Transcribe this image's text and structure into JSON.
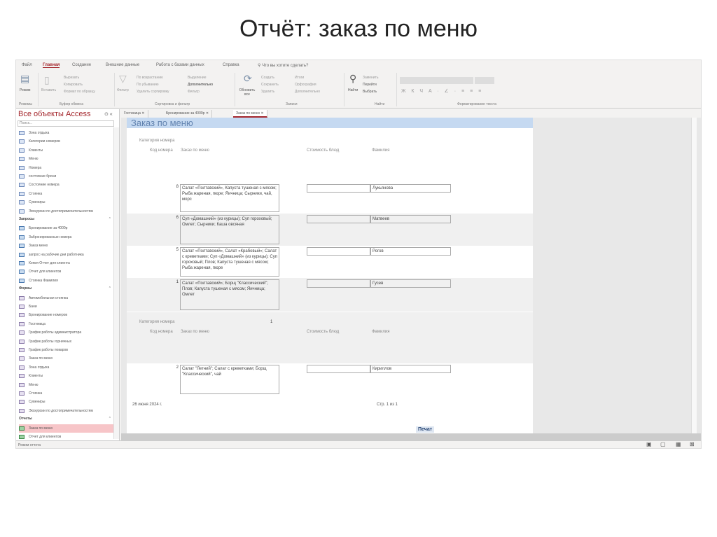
{
  "slide_title": "Отчёт: заказ по меню",
  "ribbon": {
    "menu": [
      "Файл",
      "Главная",
      "Создание",
      "Внешние данные",
      "Работа с базами данных",
      "Справка"
    ],
    "tell_me": "Что вы хотите сделать?",
    "views": {
      "label": "Режимы",
      "button": "Режим"
    },
    "clipboard": {
      "label": "Буфер обмена",
      "paste": "Вставить",
      "cut": "Вырезать",
      "copy": "Копировать",
      "format_painter": "Формат по образцу"
    },
    "sort_filter": {
      "label": "Сортировка и фильтр",
      "filter": "Фильтр",
      "asc": "По возрастанию",
      "desc": "По убыванию",
      "remove_sort": "Удалить сортировку",
      "selection": "Выделение",
      "advanced": "Дополнительно",
      "toggle": "Фильтр"
    },
    "records": {
      "label": "Записи",
      "refresh": "Обновить все",
      "new": "Создать",
      "save": "Сохранить",
      "delete": "Удалить",
      "totals": "Итоги",
      "spelling": "Орфография",
      "more": "Дополнительно"
    },
    "find": {
      "label": "Найти",
      "find": "Найти",
      "replace": "Заменить",
      "goto": "Перейти",
      "select": "Выбрать"
    },
    "text_format": {
      "label": "Форматирование текста"
    }
  },
  "nav": {
    "title": "Все объекты Access",
    "search_placeholder": "Поиск...",
    "tables": [
      "Зона отдыха",
      "Категории номеров",
      "Клиенты",
      "Меню",
      "Номера",
      "состояние брони",
      "Состояние номера",
      "Стоянка",
      "Сувениры",
      "Экскурсии по достопримечательностям"
    ],
    "queries_header": "Запросы",
    "queries": [
      "Бронирование за 4000р",
      "Забронированные номера",
      "Заказ меню",
      "запрос на рабочие дни работника",
      "Копия Отчет для клиента",
      "Отчет для клиентов",
      "Стоянка Фамилия"
    ],
    "forms_header": "Формы",
    "forms": [
      "Автомобильная стоянка",
      "Бани",
      "Бронирование номеров",
      "Гостиница",
      "График работы администратора",
      "График работы горничных",
      "График работы поваров",
      "Заказ по меню",
      "Зона отдыха",
      "Клиенты",
      "Меню",
      "Стоянка",
      "Сувениры",
      "Экскурсии по достопримечательностям"
    ],
    "reports_header": "Отчеты",
    "reports": [
      "Заказ по меню",
      "Отчет для клиентов"
    ]
  },
  "tabs": [
    "Гостиница",
    "Бронирование за 4000р",
    "Заказ по меню"
  ],
  "report": {
    "title": "Заказ по меню",
    "group_label": "Категория номера",
    "col_code": "Код номера",
    "col_order": "Заказ по меню",
    "col_cost": "Стоимость блюд",
    "col_name": "Фамилия",
    "group2_value": "1",
    "rows": [
      {
        "code": "8",
        "order": "Салат «Полтавский», Капуста тушеная с мясом; Рыба жареная, пюре; Яичница; Сырники, чай, морс",
        "cost": "",
        "name": "Лукьянова"
      },
      {
        "code": "6",
        "order": "Суп «Домашний» (из курицы); Суп гороховый; Омлет; Сырники; Каша овсяная",
        "cost": "",
        "name": "Матвеев"
      },
      {
        "code": "5",
        "order": "Салат «Полтавский», Салат «Крабовый»; Салат с креветками; Суп «Домашний» (из курицы); Суп гороховый; Плов; Капуста тушеная с мясом; Рыба жареная, пюре",
        "cost": "",
        "name": "Рогов"
      },
      {
        "code": "1",
        "order": "Салат «Полтавский»; Борщ \"Классический\"; Плов; Капуста тушеная с мясом; Яичница; Омлет",
        "cost": "",
        "name": "Гусев"
      },
      {
        "code": "2",
        "order": "Салат \"Летний\"; Салат с креветками; Борщ \"Классический\", чай",
        "cost": "",
        "name": "Кириллов"
      }
    ],
    "footer_date": "26 июня 2024 г.",
    "footer_page": "Стр. 1 из 1",
    "print_button": "Печат"
  },
  "status": "Режим отчета"
}
